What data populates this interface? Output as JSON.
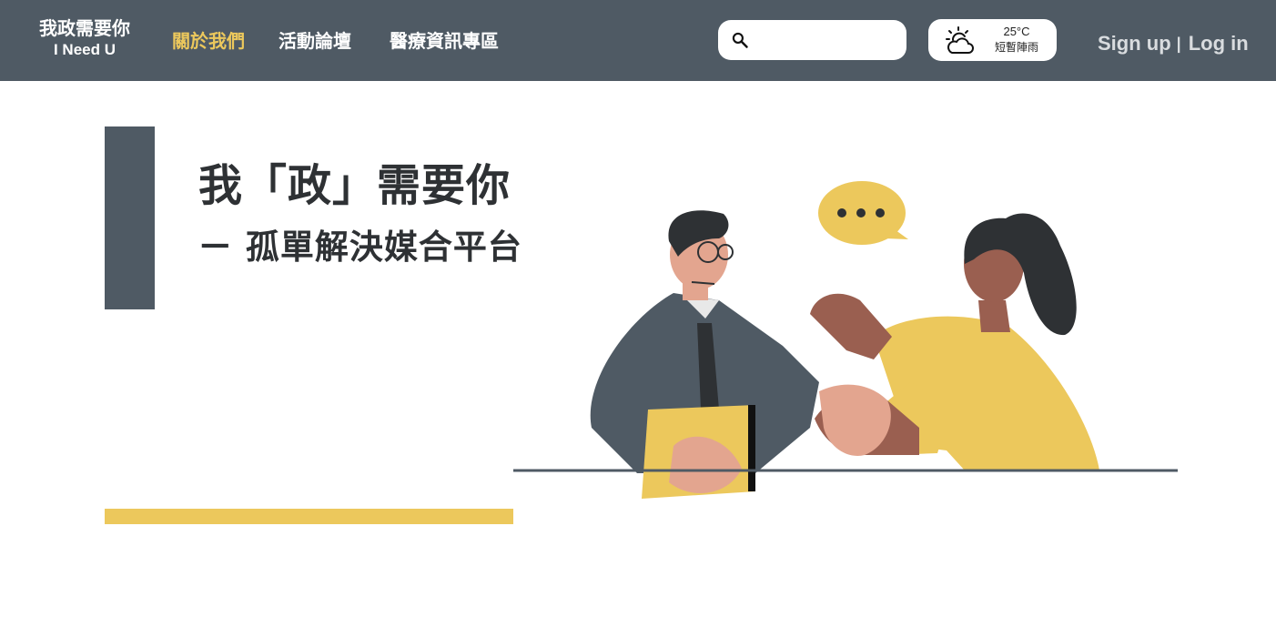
{
  "brand": {
    "name_zh": "我政需要你",
    "name_en": "I Need U"
  },
  "nav": {
    "items": [
      {
        "label": "關於我們",
        "active": true
      },
      {
        "label": "活動論壇",
        "active": false
      },
      {
        "label": "醫療資訊專區",
        "active": false
      }
    ]
  },
  "search": {
    "placeholder": "",
    "value": "",
    "icon": "search-icon"
  },
  "weather": {
    "temperature": "25°C",
    "description": "短暫陣雨",
    "icon": "sun-cloud-icon"
  },
  "auth": {
    "signup_label": "Sign up",
    "separator": "|",
    "login_label": "Log in"
  },
  "hero": {
    "title": "我「政」需要你",
    "subtitle": "ㄧ 孤單解決媒合平台"
  },
  "colors": {
    "nav_bg": "#4f5a64",
    "accent": "#ecc85c",
    "text_dark": "#2e3134",
    "nav_text": "#ffffff",
    "auth_text": "#d9dcdf"
  }
}
